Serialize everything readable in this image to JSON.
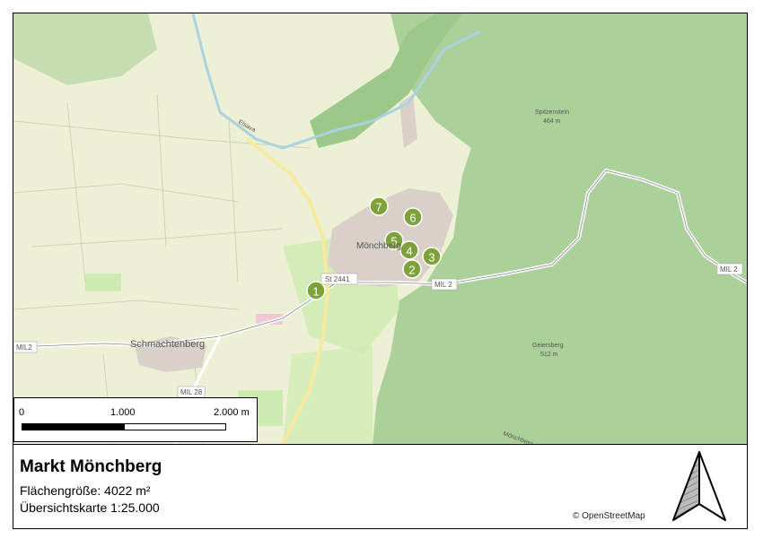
{
  "map": {
    "markers": [
      {
        "label": "1"
      },
      {
        "label": "2"
      },
      {
        "label": "3"
      },
      {
        "label": "4"
      },
      {
        "label": "5"
      },
      {
        "label": "6"
      },
      {
        "label": "7"
      }
    ],
    "place_labels": {
      "village": "Mönchberg",
      "hamlet": "Schmachtenberg",
      "road_st": "St 2441",
      "road_mil2_east": "MIL 2",
      "road_mil2_far": "MIL 2",
      "road_mil2_west": "MIL2",
      "road_mil28": "MIL 28",
      "peak1": "Spitzenstein",
      "peak1_ele": "464 m",
      "peak2": "Geiersberg",
      "peak2_ele": "512 m",
      "stream": "Elsava",
      "south": "Mönchberg"
    }
  },
  "scalebar": {
    "tick_0": "0",
    "tick_1": "1.000",
    "tick_2": "2.000 m"
  },
  "legend": {
    "title": "Markt Mönchberg",
    "area": "Flächengröße: 4022 m²",
    "scale": "Übersichtskarte 1:25.000",
    "attribution": "© OpenStreetMap"
  },
  "colors": {
    "forest": "#acd09a",
    "farmland": "#eef0d5",
    "meadow": "#cdebb0",
    "marker": "#7ea23a"
  }
}
